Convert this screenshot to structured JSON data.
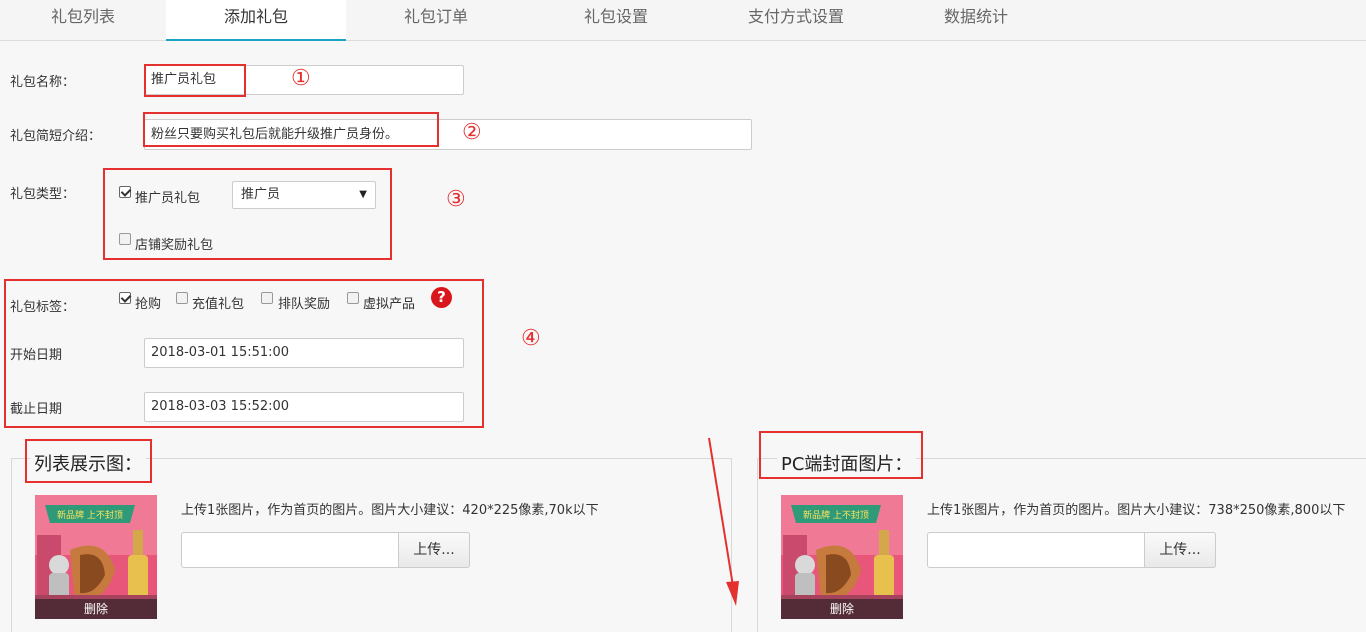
{
  "tabs": [
    {
      "label": "礼包列表"
    },
    {
      "label": "添加礼包"
    },
    {
      "label": "礼包订单"
    },
    {
      "label": "礼包设置"
    },
    {
      "label": "支付方式设置"
    },
    {
      "label": "数据统计"
    }
  ],
  "active_tab": "添加礼包",
  "form": {
    "name_label": "礼包名称：",
    "name_value": "推广员礼包",
    "intro_label": "礼包简短介绍：",
    "intro_value": "粉丝只要购买礼包后就能升级推广员身份。",
    "type_label": "礼包类型：",
    "type_opt1": "推广员礼包",
    "type_opt1_checked": true,
    "type_select": "推广员",
    "type_opt2": "店铺奖励礼包",
    "type_opt2_checked": false,
    "tags_label": "礼包标签：",
    "tags": [
      {
        "label": "抢购",
        "checked": true
      },
      {
        "label": "充值礼包",
        "checked": false
      },
      {
        "label": "排队奖励",
        "checked": false
      },
      {
        "label": "虚拟产品",
        "checked": false
      }
    ],
    "help_icon": "?",
    "start_label": "开始日期",
    "start_value": "2018-03-01 15:51:00",
    "end_label": "截止日期",
    "end_value": "2018-03-03 15:52:00"
  },
  "annotations": [
    "①",
    "②",
    "③",
    "④"
  ],
  "list_image": {
    "legend": "列表展示图：",
    "hint": "上传1张图片，作为首页的图片。图片大小建议：420*225像素,70k以下",
    "upload": "上传...",
    "delete": "删除"
  },
  "pc_image": {
    "legend": "PC端封面图片：",
    "hint": "上传1张图片，作为首页的图片。图片大小建议：738*250像素,800以下",
    "upload": "上传...",
    "delete": "删除"
  },
  "thumb_banner": "新品牌 上不封顶",
  "colors": {
    "accent": "#1aa3c4",
    "annotation_red": "#e53030"
  }
}
